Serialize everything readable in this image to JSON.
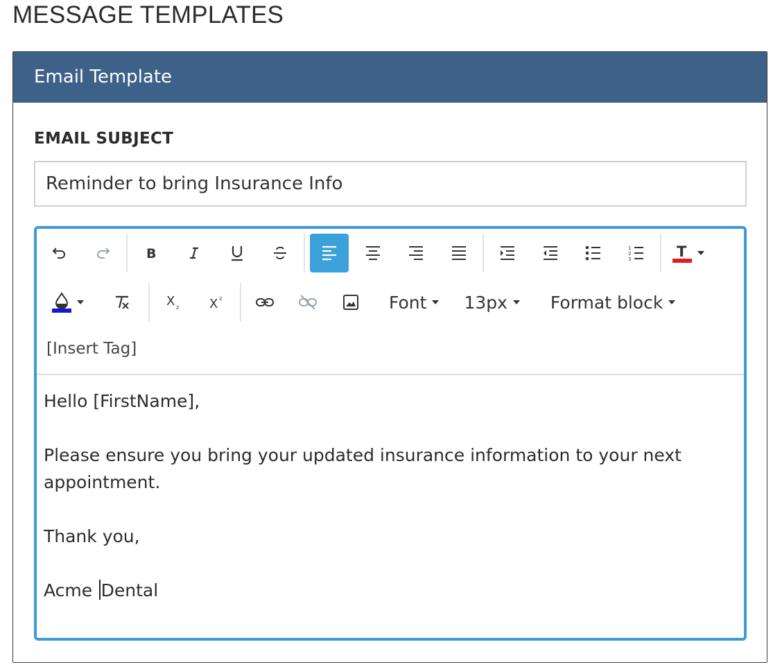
{
  "page": {
    "title": "MESSAGE TEMPLATES"
  },
  "panel": {
    "header": "Email Template"
  },
  "subject": {
    "label": "EMAIL SUBJECT",
    "value": "Reminder to bring Insurance Info"
  },
  "toolbar": {
    "font_label": "Font",
    "size_label": "13px",
    "format_label": "Format block",
    "insert_tag_label": "[Insert Tag]",
    "text_color": "#e01b1b",
    "highlight_color": "#1414d6",
    "active_button": "align-left",
    "disabled_buttons": [
      "redo",
      "unlink"
    ]
  },
  "body": {
    "greeting": "Hello [FirstName],",
    "paragraph": "Please ensure you bring your updated insurance information to your next appointment.",
    "closing": "Thank you,",
    "signature_part1": "Acme ",
    "signature_part2": "Dental"
  },
  "colors": {
    "header_bg": "#3d6189",
    "editor_border": "#3d9ad2",
    "active_button_bg": "#3ba1da"
  }
}
